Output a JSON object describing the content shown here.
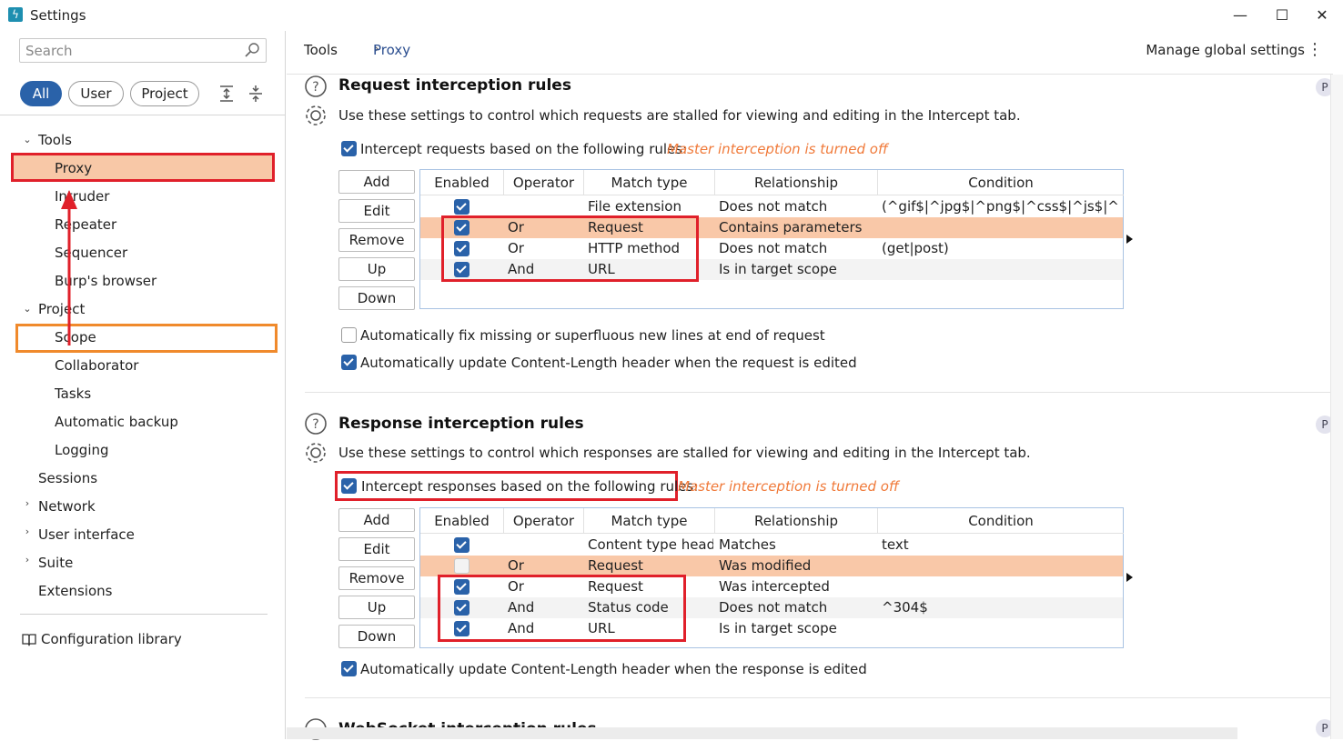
{
  "window": {
    "title": "Settings",
    "minimize": "—",
    "maximize": "☐",
    "close": "✕"
  },
  "sidebar": {
    "search_placeholder": "Search",
    "filters": [
      "All",
      "User",
      "Project"
    ],
    "tree": {
      "tools": "Tools",
      "proxy": "Proxy",
      "intruder": "Intruder",
      "repeater": "Repeater",
      "sequencer": "Sequencer",
      "burps_browser": "Burp's browser",
      "project": "Project",
      "scope": "Scope",
      "collaborator": "Collaborator",
      "tasks": "Tasks",
      "automatic_backup": "Automatic backup",
      "logging": "Logging",
      "sessions": "Sessions",
      "network": "Network",
      "user_interface": "User interface",
      "suite": "Suite",
      "extensions": "Extensions"
    },
    "config_library": "Configuration library"
  },
  "header": {
    "breadcrumb_root": "Tools",
    "breadcrumb_current": "Proxy",
    "breadcrumb_separator": "›",
    "manage_global": "Manage global settings",
    "kebab": "⋮"
  },
  "badge": "P",
  "request_section": {
    "title": "Request interception rules",
    "description": "Use these settings to control which requests are stalled for viewing and editing in the Intercept tab.",
    "intercept_label": "Intercept requests based on the following rules:",
    "master_warning": "Master interception is turned off",
    "buttons": [
      "Add",
      "Edit",
      "Remove",
      "Up",
      "Down"
    ],
    "columns": [
      "Enabled",
      "Operator",
      "Match type",
      "Relationship",
      "Condition"
    ],
    "rows": [
      {
        "enabled": true,
        "operator": "",
        "match_type": "File extension",
        "relationship": "Does not match",
        "condition": "(^gif$|^jpg$|^png$|^css$|^js$|^ico..."
      },
      {
        "enabled": true,
        "operator": "Or",
        "match_type": "Request",
        "relationship": "Contains parameters",
        "condition": ""
      },
      {
        "enabled": true,
        "operator": "Or",
        "match_type": "HTTP method",
        "relationship": "Does not match",
        "condition": "(get|post)"
      },
      {
        "enabled": true,
        "operator": "And",
        "match_type": "URL",
        "relationship": "Is in target scope",
        "condition": ""
      }
    ],
    "option_fix_newlines": "Automatically fix missing or superfluous new lines at end of request",
    "option_content_length": "Automatically update Content-Length header when the request is edited"
  },
  "response_section": {
    "title": "Response interception rules",
    "description": "Use these settings to control which responses are stalled for viewing and editing in the Intercept tab.",
    "intercept_label": "Intercept responses based on the following rules:",
    "master_warning": "Master interception is turned off",
    "buttons": [
      "Add",
      "Edit",
      "Remove",
      "Up",
      "Down"
    ],
    "columns": [
      "Enabled",
      "Operator",
      "Match type",
      "Relationship",
      "Condition"
    ],
    "rows": [
      {
        "enabled": true,
        "operator": "",
        "match_type": "Content type head...",
        "relationship": "Matches",
        "condition": "text"
      },
      {
        "enabled": false,
        "operator": "Or",
        "match_type": "Request",
        "relationship": "Was modified",
        "condition": ""
      },
      {
        "enabled": true,
        "operator": "Or",
        "match_type": "Request",
        "relationship": "Was intercepted",
        "condition": ""
      },
      {
        "enabled": true,
        "operator": "And",
        "match_type": "Status code",
        "relationship": "Does not match",
        "condition": "^304$"
      },
      {
        "enabled": true,
        "operator": "And",
        "match_type": "URL",
        "relationship": "Is in target scope",
        "condition": ""
      }
    ],
    "option_content_length": "Automatically update Content-Length header when the response is edited"
  },
  "websocket_section": {
    "title": "WebSocket interception rules"
  }
}
